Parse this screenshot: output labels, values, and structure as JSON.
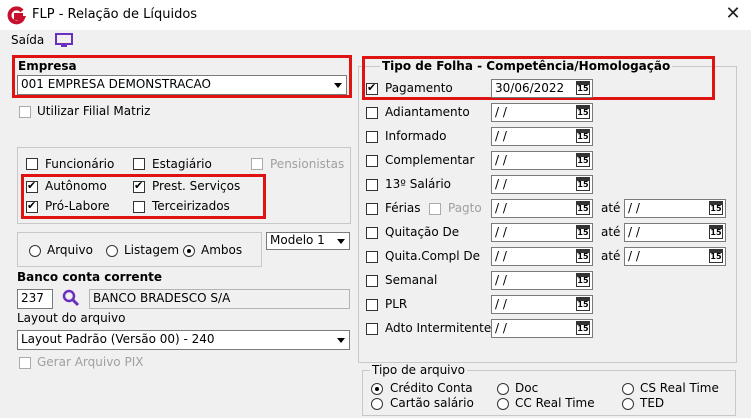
{
  "window": {
    "title": "FLP - Relação de Líquidos"
  },
  "menu": {
    "saida": "Saída"
  },
  "empresa": {
    "label": "Empresa",
    "value": "001 EMPRESA DEMONSTRACAO",
    "utilizar_filial": "Utilizar Filial Matriz"
  },
  "categorias": {
    "funcionario": "Funcionário",
    "estagiario": "Estagiário",
    "pensionistas": "Pensionistas",
    "autonomo": "Autônomo",
    "prest_servicos": "Prest. Serviços",
    "pro_labore": "Pró-Labore",
    "terceirizados": "Terceirizados"
  },
  "saida_tipo": {
    "arquivo": "Arquivo",
    "listagem": "Listagem",
    "ambos": "Ambos",
    "modelo": "Modelo 1"
  },
  "banco": {
    "label": "Banco conta corrente",
    "codigo": "237",
    "nome": "BANCO BRADESCO S/A"
  },
  "layout": {
    "label": "Layout do arquivo",
    "value": "Layout Padrão (Versão 00) - 240",
    "gerar_pix": "Gerar Arquivo PIX"
  },
  "folha": {
    "title": "Tipo de Folha  -  Competência/Homologação",
    "ate": "até",
    "pagto": "Pagto",
    "cal_label": "15",
    "rows": [
      {
        "label": "Pagamento",
        "checked": true,
        "date": "30/06/2022"
      },
      {
        "label": "Adiantamento",
        "checked": false,
        "date": " / /"
      },
      {
        "label": "Informado",
        "checked": false,
        "date": " / /"
      },
      {
        "label": "Complementar",
        "checked": false,
        "date": " / /"
      },
      {
        "label": "13º Salário",
        "checked": false,
        "date": " / /"
      },
      {
        "label": "Férias",
        "checked": false,
        "date": " / /",
        "date2": " / /"
      },
      {
        "label": "Quitação De",
        "checked": false,
        "date": " / /",
        "date2": " / /"
      },
      {
        "label": "Quita.Compl De",
        "checked": false,
        "date": " / /",
        "date2": " / /"
      },
      {
        "label": "Semanal",
        "checked": false,
        "date": " / /"
      },
      {
        "label": "PLR",
        "checked": false,
        "date": " / /"
      },
      {
        "label": "Adto Intermitente",
        "checked": false,
        "date": " / /"
      }
    ]
  },
  "tipo_arquivo": {
    "label": "Tipo de arquivo",
    "credito_conta": "Crédito Conta",
    "doc": "Doc",
    "cs_real_time": "CS Real Time",
    "cartao_salario": "Cartão salário",
    "cc_real_time": "CC Real Time",
    "ted": "TED"
  },
  "colors": {
    "highlight": "#e01313",
    "logo": "#c8102e",
    "icon": "#6b2fbf"
  },
  "icons": {
    "logo": "g-logo-icon",
    "monitor": "monitor-icon",
    "search": "search-icon",
    "calendar": "calendar-icon"
  }
}
